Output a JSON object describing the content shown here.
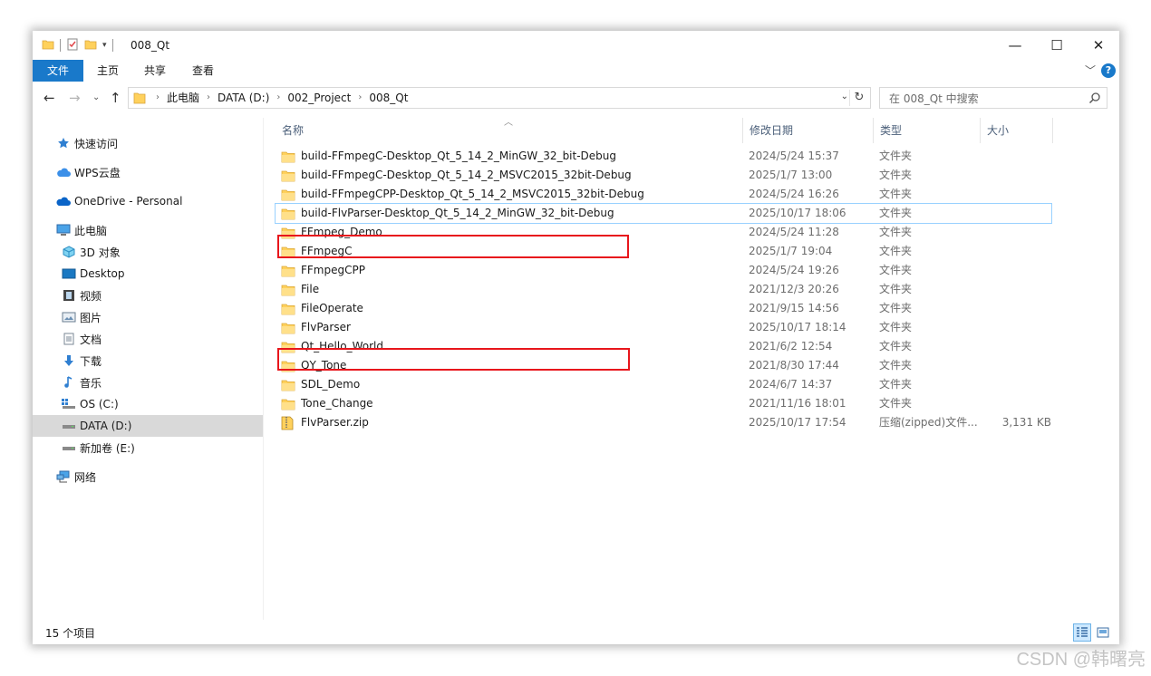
{
  "window": {
    "title": "008_Qt"
  },
  "window_controls": {
    "minimize": "—",
    "maximize": "☐",
    "close": "✕"
  },
  "ribbon": {
    "tabs": [
      "文件",
      "主页",
      "共享",
      "查看"
    ],
    "help": "?"
  },
  "address_bar": {
    "crumbs": [
      "此电脑",
      "DATA (D:)",
      "002_Project",
      "008_Qt"
    ]
  },
  "search": {
    "placeholder": "在 008_Qt 中搜索"
  },
  "sidebar": {
    "items": [
      {
        "label": "快速访问",
        "icon": "star-icon"
      },
      {
        "label": "WPS云盘",
        "icon": "cloud-icon"
      },
      {
        "label": "OneDrive - Personal",
        "icon": "onedrive-icon"
      },
      {
        "label": "此电脑",
        "icon": "computer-icon"
      },
      {
        "label": "3D 对象",
        "icon": "cube-icon"
      },
      {
        "label": "Desktop",
        "icon": "desktop-icon"
      },
      {
        "label": "视频",
        "icon": "video-icon"
      },
      {
        "label": "图片",
        "icon": "picture-icon"
      },
      {
        "label": "文档",
        "icon": "document-icon"
      },
      {
        "label": "下载",
        "icon": "download-icon"
      },
      {
        "label": "音乐",
        "icon": "music-icon"
      },
      {
        "label": "OS (C:)",
        "icon": "drive-c-icon"
      },
      {
        "label": "DATA (D:)",
        "icon": "drive-icon",
        "selected": true
      },
      {
        "label": "新加卷 (E:)",
        "icon": "drive-icon"
      },
      {
        "label": "网络",
        "icon": "network-icon"
      }
    ]
  },
  "columns": {
    "name": "名称",
    "date": "修改日期",
    "type": "类型",
    "size": "大小"
  },
  "files": [
    {
      "name": "build-FFmpegC-Desktop_Qt_5_14_2_MinGW_32_bit-Debug",
      "date": "2024/5/24 15:37",
      "type": "文件夹",
      "size": "",
      "icon": "folder-icon"
    },
    {
      "name": "build-FFmpegC-Desktop_Qt_5_14_2_MSVC2015_32bit-Debug",
      "date": "2025/1/7 13:00",
      "type": "文件夹",
      "size": "",
      "icon": "folder-icon"
    },
    {
      "name": "build-FFmpegCPP-Desktop_Qt_5_14_2_MSVC2015_32bit-Debug",
      "date": "2024/5/24 16:26",
      "type": "文件夹",
      "size": "",
      "icon": "folder-icon"
    },
    {
      "name": "build-FlvParser-Desktop_Qt_5_14_2_MinGW_32_bit-Debug",
      "date": "2025/10/17 18:06",
      "type": "文件夹",
      "size": "",
      "icon": "folder-icon",
      "highlighted": true
    },
    {
      "name": "FFmpeg_Demo",
      "date": "2024/5/24 11:28",
      "type": "文件夹",
      "size": "",
      "icon": "folder-icon"
    },
    {
      "name": "FFmpegC",
      "date": "2025/1/7 19:04",
      "type": "文件夹",
      "size": "",
      "icon": "folder-icon"
    },
    {
      "name": "FFmpegCPP",
      "date": "2024/5/24 19:26",
      "type": "文件夹",
      "size": "",
      "icon": "folder-icon"
    },
    {
      "name": "File",
      "date": "2021/12/3 20:26",
      "type": "文件夹",
      "size": "",
      "icon": "folder-icon"
    },
    {
      "name": "FileOperate",
      "date": "2021/9/15 14:56",
      "type": "文件夹",
      "size": "",
      "icon": "folder-icon"
    },
    {
      "name": "FlvParser",
      "date": "2025/10/17 18:14",
      "type": "文件夹",
      "size": "",
      "icon": "folder-icon"
    },
    {
      "name": "Qt_Hello_World",
      "date": "2021/6/2 12:54",
      "type": "文件夹",
      "size": "",
      "icon": "folder-icon"
    },
    {
      "name": "QY_Tone",
      "date": "2021/8/30 17:44",
      "type": "文件夹",
      "size": "",
      "icon": "folder-icon"
    },
    {
      "name": "SDL_Demo",
      "date": "2024/6/7 14:37",
      "type": "文件夹",
      "size": "",
      "icon": "folder-icon"
    },
    {
      "name": "Tone_Change",
      "date": "2021/11/16 18:01",
      "type": "文件夹",
      "size": "",
      "icon": "folder-icon"
    },
    {
      "name": "FlvParser.zip",
      "date": "2025/10/17 17:54",
      "type": "压缩(zipped)文件...",
      "size": "3,131 KB",
      "icon": "zip-icon"
    }
  ],
  "status": {
    "count_text": "15 个项目"
  },
  "watermark": "CSDN @韩曙亮",
  "colors": {
    "accent": "#1979ca",
    "annotation_red": "#e8161c",
    "folder": "#ffd15c"
  }
}
